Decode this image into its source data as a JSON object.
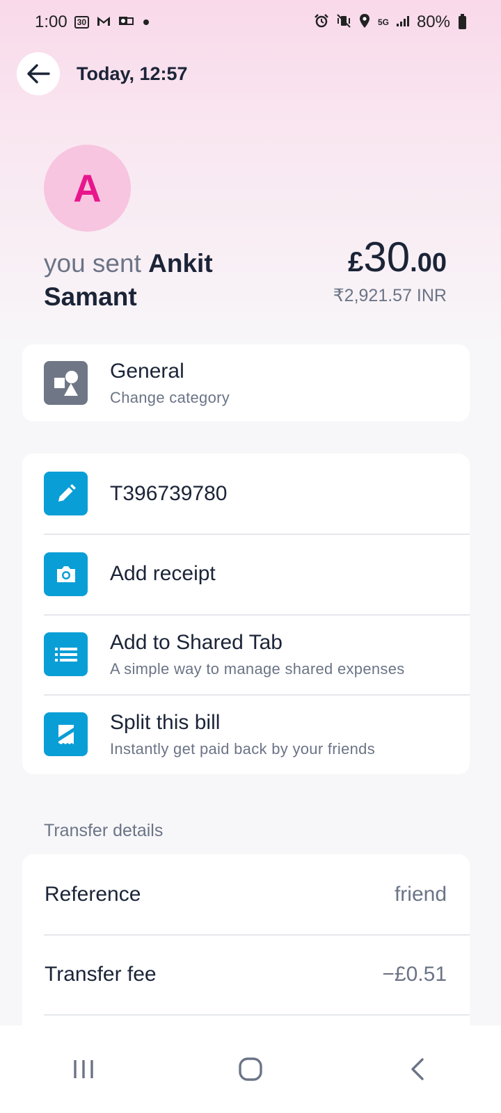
{
  "status_bar": {
    "time": "1:00",
    "left_icons": [
      "calendar-30-icon",
      "gmail-icon",
      "outlook-icon",
      "notification-dot-icon"
    ],
    "calendar_badge": "30",
    "right_icons": [
      "alarm-icon",
      "vibrate-icon",
      "location-icon",
      "5g-icon",
      "signal-icon",
      "battery-icon"
    ],
    "network_label": "5G",
    "battery": "80%"
  },
  "header": {
    "title": "Today, 12:57"
  },
  "recipient": {
    "avatar_letter": "A",
    "prefix": "you sent ",
    "name": "Ankit Samant"
  },
  "amount": {
    "currency_symbol": "£",
    "whole": "30",
    "fraction": ".00",
    "converted": "₹2,921.57 INR"
  },
  "category_card": {
    "title": "General",
    "subtitle": "Change category"
  },
  "actions": [
    {
      "title": "T396739780",
      "subtitle": ""
    },
    {
      "title": "Add receipt",
      "subtitle": ""
    },
    {
      "title": "Add to Shared Tab",
      "subtitle": "A simple way to manage shared expenses"
    },
    {
      "title": "Split this bill",
      "subtitle": "Instantly get paid back by your friends"
    }
  ],
  "transfer_details": {
    "heading": "Transfer details",
    "rows": [
      {
        "label": "Reference",
        "value": "friend"
      },
      {
        "label": "Transfer fee",
        "value": "−£0.51"
      }
    ]
  },
  "colors": {
    "accent_pink": "#e8168c",
    "avatar_bg": "#f7c5e0",
    "icon_blue": "#0a9ed6",
    "icon_gray": "#6f7786",
    "text_dark": "#1b2437",
    "text_muted": "#6b7486"
  }
}
